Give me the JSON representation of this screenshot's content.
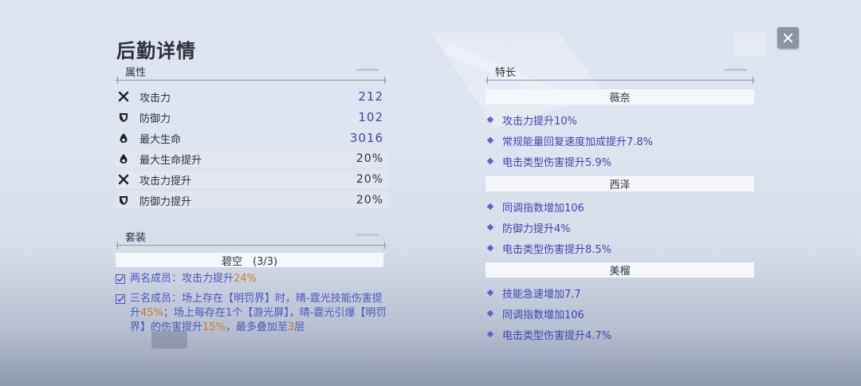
{
  "title": "后勤详情",
  "close_glyph": "✕",
  "attributes": {
    "header": "属性",
    "rows": [
      {
        "icon": "crossed-swords-icon",
        "name": "攻击力",
        "value": "212",
        "highlight": false
      },
      {
        "icon": "shield-icon",
        "name": "防御力",
        "value": "102",
        "highlight": false
      },
      {
        "icon": "droplet-icon",
        "name": "最大生命",
        "value": "3016",
        "highlight": false
      },
      {
        "icon": "droplet-icon",
        "name": "最大生命提升",
        "value": "20%",
        "highlight": true
      },
      {
        "icon": "crossed-swords-icon",
        "name": "攻击力提升",
        "value": "20%",
        "highlight": true
      },
      {
        "icon": "shield-icon",
        "name": "防御力提升",
        "value": "20%",
        "highlight": true
      }
    ]
  },
  "set": {
    "header": "套装",
    "name_bar": "碧空　(3/3)",
    "two_piece": {
      "prefix": "两名成员：攻击力提升",
      "value": "24%"
    },
    "three_piece": {
      "part1": "三名成员：场上存在【明罚界】时，晴-霆光技能伤害提升",
      "value1": "45%",
      "part2": "；场上每存在1个【游光屏】，晴-霆光引爆【明罚界】的伤害提升",
      "value2": "15%",
      "part3": "，最多叠加至",
      "value3": "3",
      "part4": "层"
    }
  },
  "specialties": {
    "header": "特长",
    "groups": [
      {
        "name": "薇奈",
        "skills": [
          "攻击力提升10%",
          "常规能量回复速度加成提升7.8%",
          "电击类型伤害提升5.9%"
        ]
      },
      {
        "name": "西泽",
        "skills": [
          "同调指数增加106",
          "防御力提升4%",
          "电击类型伤害提升8.5%"
        ]
      },
      {
        "name": "美榴",
        "skills": [
          "技能急速增加7.7",
          "同调指数增加106",
          "电击类型伤害提升4.7%"
        ]
      }
    ]
  },
  "colors": {
    "value_blue": "#3f45a5",
    "highlight_orange": "#d27a22",
    "skill_blue": "#3e44b4"
  }
}
